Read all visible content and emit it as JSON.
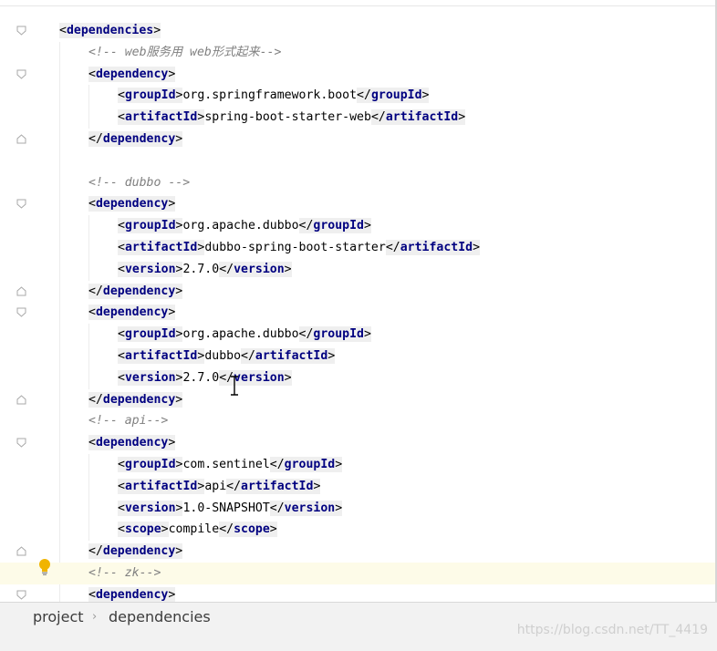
{
  "editor": {
    "lines": [
      {
        "kind": "open",
        "indent": 0,
        "tag": "dependencies",
        "fold": "open"
      },
      {
        "kind": "comment",
        "indent": 1,
        "text": "<!-- web服务用 web形式起来-->"
      },
      {
        "kind": "open",
        "indent": 1,
        "tag": "dependency",
        "fold": "open"
      },
      {
        "kind": "elem",
        "indent": 2,
        "tag": "groupId",
        "value": "org.springframework.boot"
      },
      {
        "kind": "elem",
        "indent": 2,
        "tag": "artifactId",
        "value": "spring-boot-starter-web"
      },
      {
        "kind": "close",
        "indent": 1,
        "tag": "dependency",
        "fold": "close"
      },
      {
        "kind": "blank",
        "indent": 0
      },
      {
        "kind": "comment",
        "indent": 1,
        "text": "<!-- dubbo -->"
      },
      {
        "kind": "open",
        "indent": 1,
        "tag": "dependency",
        "fold": "open"
      },
      {
        "kind": "elem",
        "indent": 2,
        "tag": "groupId",
        "value": "org.apache.dubbo"
      },
      {
        "kind": "elem",
        "indent": 2,
        "tag": "artifactId",
        "value": "dubbo-spring-boot-starter"
      },
      {
        "kind": "elem",
        "indent": 2,
        "tag": "version",
        "value": "2.7.0"
      },
      {
        "kind": "close",
        "indent": 1,
        "tag": "dependency",
        "fold": "close"
      },
      {
        "kind": "open",
        "indent": 1,
        "tag": "dependency",
        "fold": "open"
      },
      {
        "kind": "elem",
        "indent": 2,
        "tag": "groupId",
        "value": "org.apache.dubbo"
      },
      {
        "kind": "elem",
        "indent": 2,
        "tag": "artifactId",
        "value": "dubbo"
      },
      {
        "kind": "elem",
        "indent": 2,
        "tag": "version",
        "value": "2.7.0"
      },
      {
        "kind": "close",
        "indent": 1,
        "tag": "dependency",
        "fold": "close"
      },
      {
        "kind": "comment",
        "indent": 1,
        "text": "<!-- api-->"
      },
      {
        "kind": "open",
        "indent": 1,
        "tag": "dependency",
        "fold": "open"
      },
      {
        "kind": "elem",
        "indent": 2,
        "tag": "groupId",
        "value": "com.sentinel"
      },
      {
        "kind": "elem",
        "indent": 2,
        "tag": "artifactId",
        "value": "api"
      },
      {
        "kind": "elem",
        "indent": 2,
        "tag": "version",
        "value": "1.0-SNAPSHOT"
      },
      {
        "kind": "elem",
        "indent": 2,
        "tag": "scope",
        "value": "compile"
      },
      {
        "kind": "close",
        "indent": 1,
        "tag": "dependency",
        "fold": "close"
      },
      {
        "kind": "comment",
        "indent": 1,
        "text": "<!-- zk-->",
        "highlight": true,
        "bulb": true
      },
      {
        "kind": "open",
        "indent": 1,
        "tag": "dependency",
        "fold": "open"
      }
    ]
  },
  "breadcrumb": {
    "items": [
      "project",
      "dependencies"
    ],
    "separator": "›"
  },
  "watermark": "https://blog.csdn.net/TT_4419",
  "colors": {
    "tag_name": "#000080",
    "comment": "#808080",
    "tag_background": "#efefef",
    "current_line": "#fdfbe8",
    "bulb": "#f0b400"
  },
  "icons": [
    "fold-open-icon",
    "fold-close-icon",
    "lightbulb-icon",
    "text-cursor-icon"
  ]
}
